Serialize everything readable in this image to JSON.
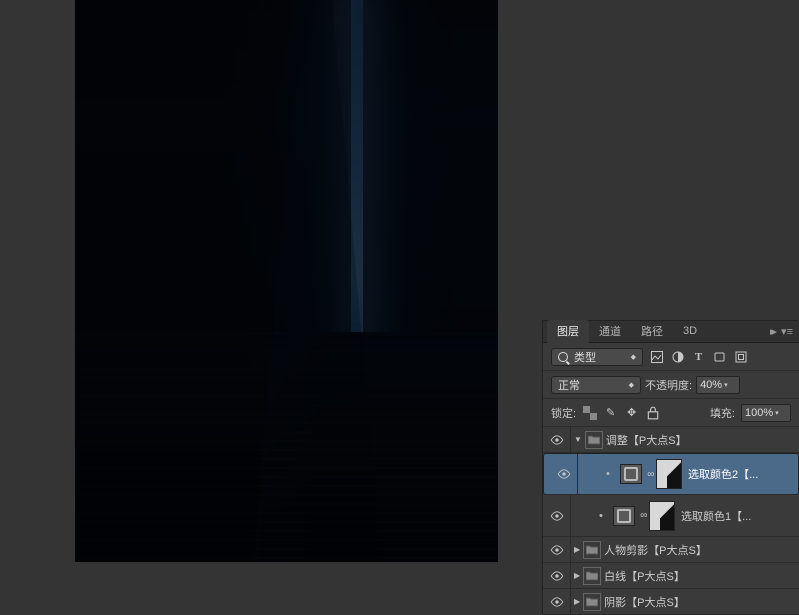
{
  "tabs": {
    "layers": "图层",
    "channels": "通道",
    "paths": "路径",
    "threeD": "3D"
  },
  "filter": {
    "label": "类型",
    "blend": "正常",
    "opacity_lbl": "不透明度:",
    "opacity": "40%",
    "lock": "锁定:",
    "fill_lbl": "填充:",
    "fill": "100%"
  },
  "layers": [
    {
      "type": "group",
      "open": true,
      "name": "调整【P大点S】",
      "indent": 0
    },
    {
      "type": "adj",
      "name": "选取颜色2【...",
      "indent": 24,
      "selected": true
    },
    {
      "type": "adj",
      "name": "选取颜色1【...",
      "indent": 24
    },
    {
      "type": "group",
      "open": false,
      "name": "人物剪影【P大点S】",
      "indent": 0
    },
    {
      "type": "group",
      "open": false,
      "name": "白线【P大点S】",
      "indent": 0
    },
    {
      "type": "group",
      "open": false,
      "name": "阴影【P大点S】",
      "indent": 0
    }
  ]
}
